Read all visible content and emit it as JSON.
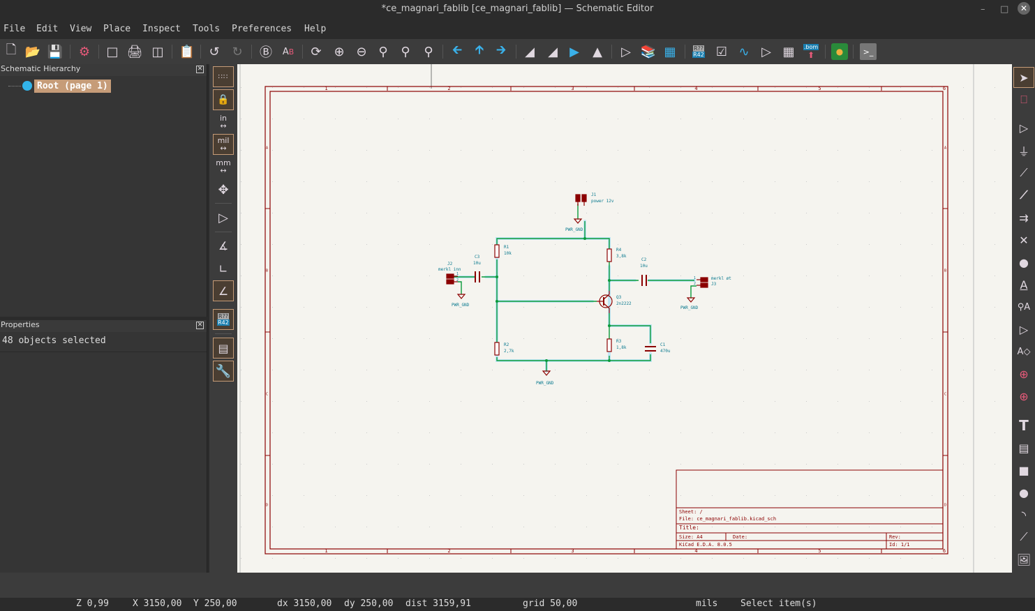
{
  "window": {
    "title": "*ce_magnari_fablib [ce_magnari_fablib] — Schematic Editor",
    "minimize": "–",
    "maximize": "□",
    "close": "✕"
  },
  "menu": [
    "File",
    "Edit",
    "View",
    "Place",
    "Inspect",
    "Tools",
    "Preferences",
    "Help"
  ],
  "toolbar": {
    "icons": [
      "new-schematic",
      "open-schematic",
      "save",
      "schematic-setup",
      "page-settings",
      "print",
      "plot",
      "paste",
      "undo",
      "redo",
      "find",
      "find-replace",
      "refresh",
      "zoom-in",
      "zoom-out",
      "zoom-fit-page",
      "zoom-fit-objects",
      "zoom-selection",
      "navigate-back",
      "navigate-up",
      "navigate-forward",
      "rotate-ccw",
      "rotate-cw",
      "mirror-vertical",
      "mirror-horizontal",
      "symbol-editor",
      "symbol-library-browser",
      "footprint-assign",
      "annotate",
      "erc",
      "simulator",
      "bus-definitions",
      "symbol-fields-table",
      "bom-generator",
      "pcb-editor",
      "scripting-console"
    ],
    "annotate_top": "R??",
    "annotate_bottom": "R42",
    "bom_label": ".bom"
  },
  "hierarchy": {
    "title": "Schematic Hierarchy",
    "root_label": "Root (page 1)"
  },
  "properties": {
    "title": "Properties",
    "selection_text": "48 objects selected"
  },
  "left_tools": {
    "units_in": "in",
    "units_mil": "mil",
    "units_mm": "mm",
    "annotate_top": "R??",
    "annotate_bottom": "R42"
  },
  "schematic": {
    "components": [
      {
        "ref": "J1",
        "value": "power 12v"
      },
      {
        "ref": "J2",
        "value": "merkl inn"
      },
      {
        "ref": "J3",
        "value": "merkl øt"
      },
      {
        "ref": "C3",
        "value": "10u"
      },
      {
        "ref": "C2",
        "value": "10u"
      },
      {
        "ref": "C1",
        "value": "470u"
      },
      {
        "ref": "R1",
        "value": "10k"
      },
      {
        "ref": "R2",
        "value": "2,7k"
      },
      {
        "ref": "R3",
        "value": "1,8k"
      },
      {
        "ref": "R4",
        "value": "3,8k"
      },
      {
        "ref": "Q3",
        "value": "2n2222"
      }
    ],
    "power_label": "PWR_GND",
    "pin_1": "1",
    "pin_2": "2",
    "frame_columns": [
      "1",
      "2",
      "3",
      "4",
      "5",
      "6"
    ],
    "frame_rows": [
      "A",
      "B",
      "C",
      "D"
    ]
  },
  "title_block": {
    "sheet": "Sheet: /",
    "file": "File: ce_magnari_fablib.kicad_sch",
    "title": "Title:",
    "size": "Size: A4",
    "date": "Date:",
    "rev": "Rev:",
    "kicad": "KiCad E.D.A. 8.0.5",
    "id": "Id: 1/1"
  },
  "status": {
    "zoom": "Z 0,99",
    "x": "X 3150,00",
    "y": "Y 250,00",
    "dx": "dx 3150,00",
    "dy": "dy 250,00",
    "dist": "dist 3159,91",
    "grid": "grid 50,00",
    "units": "mils",
    "mode": "Select item(s)"
  }
}
